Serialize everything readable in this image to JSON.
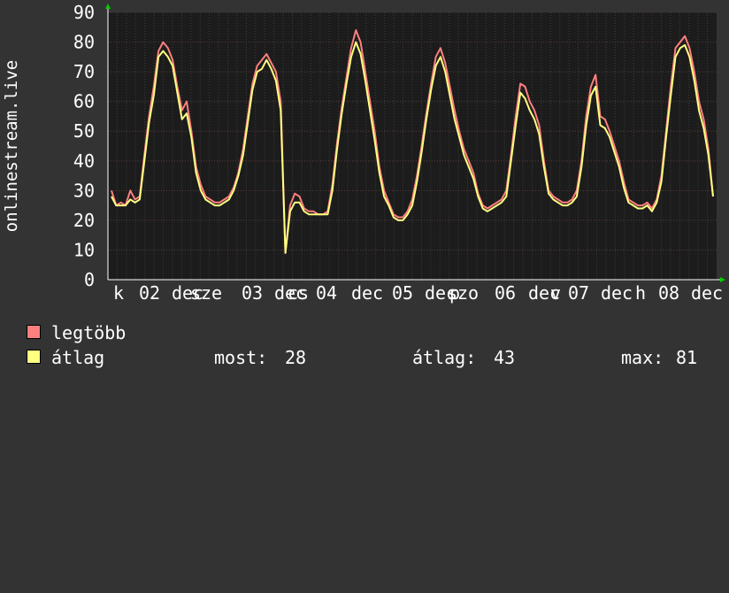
{
  "chart_data": {
    "type": "line",
    "ylabel": "onlinestream.live",
    "ylim": [
      0,
      90
    ],
    "y_ticks": [
      0,
      10,
      20,
      30,
      40,
      50,
      60,
      70,
      80,
      90
    ],
    "x_tick_labels": [
      "k",
      "02",
      "dec",
      "sze",
      "03",
      "dec",
      "cs",
      "04",
      "dec",
      "p",
      "05",
      "dec",
      "szo",
      "06",
      "dec",
      "v",
      "07",
      "dec",
      "h",
      "08",
      "dec"
    ],
    "background_color": "#333333",
    "plot_bg_color": "#1c1c1c",
    "grid": true,
    "legend_position": "bottom-left",
    "series": [
      {
        "name": "legtöbb",
        "color": "#ff7f7f",
        "values": [
          30,
          25,
          26,
          25,
          30,
          27,
          28,
          42,
          55,
          65,
          77,
          80,
          78,
          74,
          65,
          57,
          60,
          50,
          38,
          32,
          28,
          27,
          26,
          26,
          27,
          28,
          31,
          36,
          44,
          55,
          66,
          72,
          74,
          76,
          73,
          70,
          60,
          9,
          25,
          29,
          28,
          24,
          23,
          23,
          22,
          22,
          23,
          32,
          46,
          58,
          68,
          78,
          84,
          80,
          70,
          60,
          50,
          38,
          30,
          26,
          22,
          21,
          21,
          23,
          27,
          35,
          45,
          56,
          66,
          75,
          78,
          73,
          65,
          57,
          50,
          44,
          40,
          36,
          29,
          25,
          24,
          25,
          26,
          27,
          30,
          42,
          55,
          66,
          65,
          60,
          57,
          52,
          40,
          30,
          28,
          27,
          26,
          26,
          27,
          30,
          40,
          55,
          65,
          69,
          55,
          54,
          50,
          45,
          40,
          33,
          27,
          26,
          25,
          25,
          26,
          24,
          27,
          35,
          50,
          65,
          78,
          80,
          82,
          78,
          70,
          60,
          54,
          44,
          28
        ]
      },
      {
        "name": "átlag",
        "color": "#ffff80",
        "values": [
          28,
          25,
          25,
          25,
          27,
          26,
          27,
          40,
          53,
          62,
          75,
          77,
          75,
          72,
          63,
          54,
          56,
          48,
          36,
          30,
          27,
          26,
          25,
          25,
          26,
          27,
          30,
          35,
          42,
          53,
          64,
          70,
          71,
          74,
          71,
          67,
          57,
          9,
          23,
          26,
          26,
          23,
          22,
          22,
          22,
          22,
          22,
          30,
          44,
          56,
          66,
          75,
          80,
          76,
          67,
          57,
          47,
          36,
          28,
          25,
          21,
          20,
          20,
          22,
          25,
          33,
          43,
          54,
          64,
          72,
          75,
          70,
          62,
          54,
          48,
          42,
          38,
          34,
          28,
          24,
          23,
          24,
          25,
          26,
          28,
          40,
          52,
          63,
          61,
          57,
          54,
          49,
          38,
          29,
          27,
          26,
          25,
          25,
          26,
          28,
          38,
          52,
          62,
          65,
          52,
          51,
          48,
          43,
          38,
          31,
          26,
          25,
          24,
          24,
          25,
          23,
          26,
          33,
          48,
          62,
          75,
          78,
          79,
          75,
          67,
          57,
          51,
          42,
          28
        ]
      }
    ],
    "stats": {
      "now_label": "most:",
      "now_value": "28",
      "avg_label": "átlag:",
      "avg_value": "43",
      "max_label": "max:",
      "max_value": "81"
    }
  }
}
